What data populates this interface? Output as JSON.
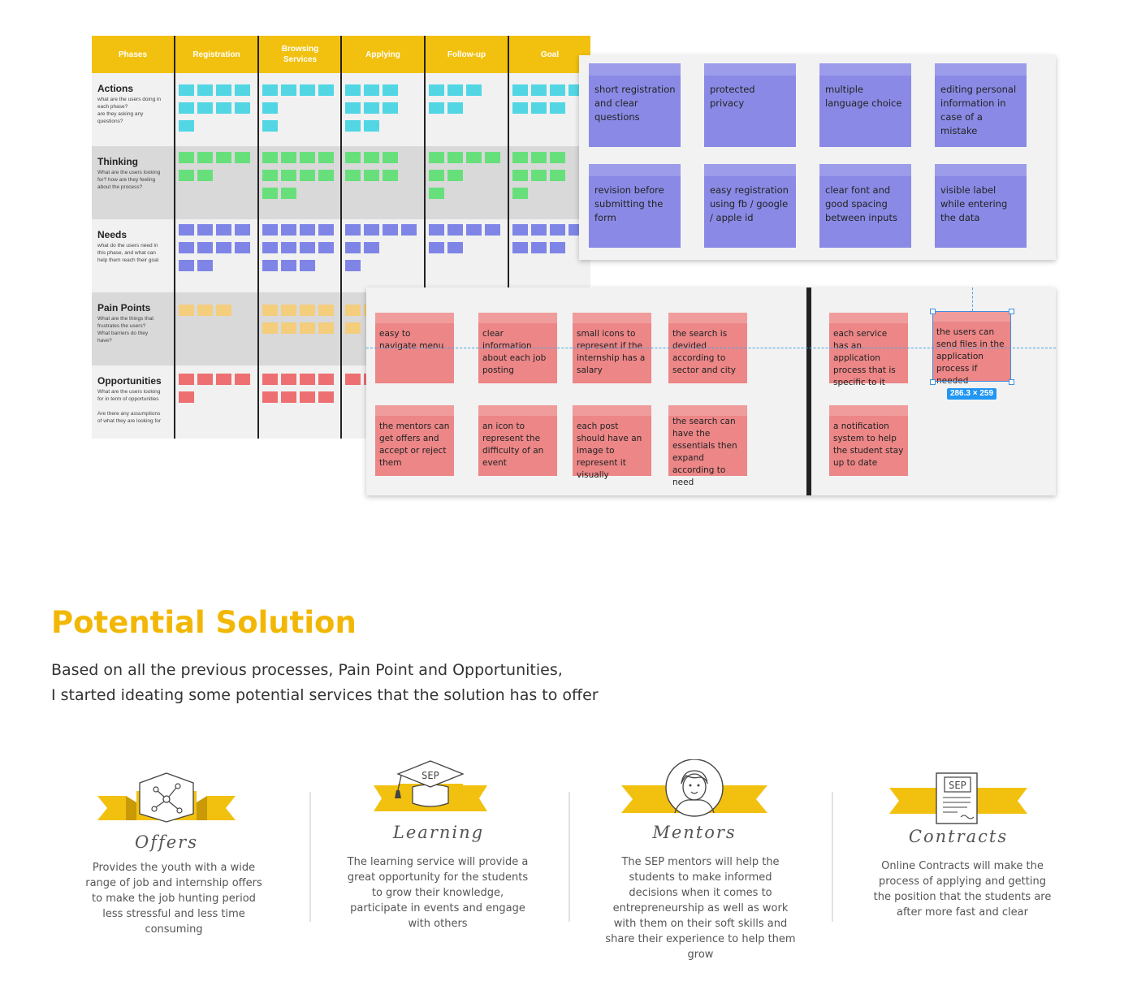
{
  "journey": {
    "phases_header": "Phases",
    "phases": [
      "Registration",
      "Browsing\nServices",
      "Applying",
      "Follow-up",
      "Goal"
    ],
    "rows": [
      {
        "title": "Actions",
        "sub": "what are the users doing in\neach phase?\nare they asking any\nquestions?"
      },
      {
        "title": "Thinking",
        "sub": "What are the users looking\nfor? how are they feeling\nabout the process?"
      },
      {
        "title": "Needs",
        "sub": "what do the users need in\nthis phase, and what can\nhelp them reach their goal"
      },
      {
        "title": "Pain Points",
        "sub": "What are the things that\nfrustrates the users?\nWhat barriers do they\nhave?"
      },
      {
        "title": "Opportunities",
        "sub": "What are the users looking\nfor in term of opportunities\n\nAre there any assumptions\nof what they are looking for"
      }
    ]
  },
  "purple_notes": [
    "short registration and clear questions",
    "protected privacy",
    "multiple language choice",
    "editing personal information in case of a mistake",
    "revision before submitting the form",
    "easy registration using fb / google / apple id",
    "clear font and good spacing between inputs",
    "visible label while entering the data"
  ],
  "red_notes": [
    "easy to navigate menu",
    "clear information about each job posting",
    "small icons to represent if the internship has a salary",
    "the search is devided according to sector and city",
    "each service has an application process that is specific to it",
    "the users can send files in the application process if needed",
    "the mentors can get offers and accept or reject them",
    "an icon to represent the difficulty of an event",
    "each post should have an image to represent it visually",
    "the search can have the essentials then expand according to need",
    "a notification system to help the student stay up to date"
  ],
  "selection_size": "286.3 × 259",
  "section": {
    "title": "Potential Solution",
    "intro_line1": "Based on all the previous processes, Pain Point and Opportunities,",
    "intro_line2": "I started ideating some potential services that the solution has to offer"
  },
  "services": [
    {
      "name": "Offers",
      "icon": "offers-network-icon",
      "desc": "Provides the youth with a wide range of job and internship offers to make the job hunting period less stressful and less time consuming"
    },
    {
      "name": "Learning",
      "icon": "graduation-cap-icon",
      "badge": "SEP",
      "desc": "The learning service will provide a great opportunity for the students to grow their knowledge, participate in events and engage with others"
    },
    {
      "name": "Mentors",
      "icon": "mentor-avatar-icon",
      "desc": "The SEP mentors will help the students to make informed decisions when it comes to entrepreneurship as well as work with them on their soft skills and share their experience to help them grow"
    },
    {
      "name": "Contracts",
      "icon": "contract-document-icon",
      "badge": "SEP",
      "desc": "Online Contracts will make the process of applying and getting the position that the students are after more fast and clear"
    }
  ],
  "colors": {
    "accent_yellow": "#f2b705",
    "purple_note": "#8a8ae6",
    "red_note": "#ec8687",
    "selection_blue": "#2196f3"
  }
}
